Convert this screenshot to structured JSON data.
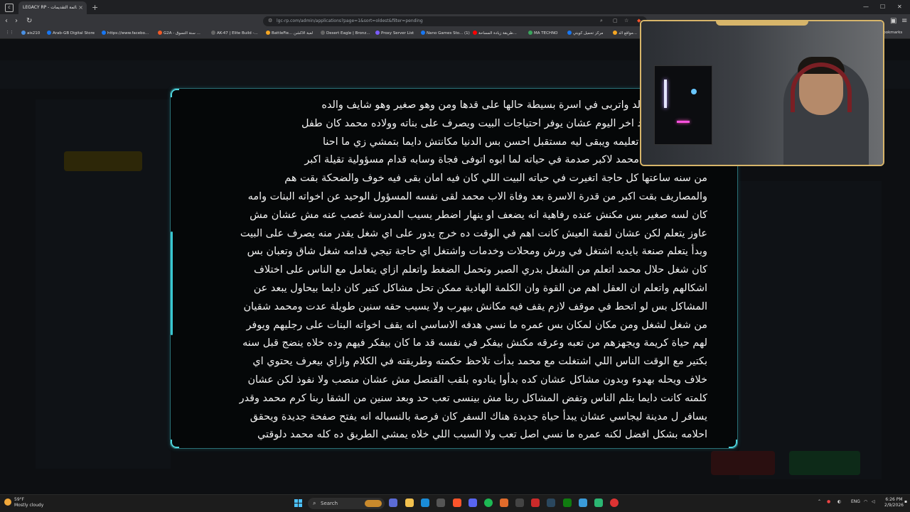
{
  "browser": {
    "tab_title": "LEGACY RP - قائمة التقديمات",
    "tab_close": "×",
    "new_tab": "+",
    "url": "lgc-rp.com/admin/applications?page=1&sort=oldest&filter=pending",
    "bookmarks": [
      {
        "label": "ais210",
        "color": "#4a90e2"
      },
      {
        "label": "Arab-GB Digital Store",
        "color": "#1877f2"
      },
      {
        "label": "https://www.facebo...",
        "color": "#1877f2"
      },
      {
        "label": "G2A - سنة التسوق ...",
        "color": "#f05a28"
      },
      {
        "label": "AK-47 | Elite Build -...",
        "color": "#666666"
      },
      {
        "label": "BattleFie... لعبة الاكشن",
        "color": "#f5a623"
      },
      {
        "label": "Desert Eagle | Bronz...",
        "color": "#666666"
      },
      {
        "label": "Proxy Server List",
        "color": "#7b5cff"
      },
      {
        "label": "Nano Games Sto... (1)",
        "color": "#1877f2"
      },
      {
        "label": "طريقة زيادة المساحة...",
        "color": "#ff0000"
      },
      {
        "label": "MA TECHNO",
        "color": "#3aa55c"
      },
      {
        "label": "مركز تحميل كويتي",
        "color": "#1877f2"
      },
      {
        "label": "مواقع الد...",
        "color": "#f5a623"
      }
    ],
    "all_bookmarks": "All Bookmarks"
  },
  "story": {
    "lines": [
      "شاب مصري اتولد واتربى في اسرة بسيطة حالها على قدها ومن وهو صغير وهو شايف والده",
      "ل من الصبح لحد اخر اليوم عشان يوفر احتياجات البيت ويصرف على بناته وولاده محمد كان طفل",
      "سة بيحلم يكمل تعليمه ويبقى ليه مستقبل احسن بس الدنيا مكانتش دايما بتمشي زي ما احنا",
      "ن صغير اتعرض محمد لاكبر صدمة في حياته لما ابوه اتوفى فجاة وسابه قدام مسؤولية تقيلة اكبر",
      "من سنه ساعتها كل حاجة اتغيرت في حياته البيت اللي كان فيه امان بقى فيه خوف والضحكة بقت هم",
      "والمصاريف بقت اكبر من قدرة الاسرة بعد وفاة الاب محمد لقى نفسه المسؤول الوحيد عن اخواته البنات وامه",
      "كان لسه صغير بس مكنش عنده رفاهية انه يضعف او ينهار اضطر يسيب المدرسة غصب عنه مش عشان مش",
      "عاوز يتعلم لكن عشان لقمة العيش كانت اهم في الوقت ده خرج يدور على اي شغل يقدر منه يصرف على البيت",
      "وبدأ يتعلم صنعة بايديه اشتغل في ورش ومحلات وخدمات واشتغل اي حاجة تيجي قدامه شغل شاق وتعبان بس",
      "كان شغل حلال محمد اتعلم من الشغل بدري الصبر وتحمل الضغط واتعلم ازاي يتعامل مع الناس على اختلاف",
      "اشكالهم واتعلم ان العقل اهم من القوة وان الكلمة الهادية ممكن تحل مشاكل كتير كان دايما بيحاول يبعد عن",
      "المشاكل بس لو اتحط في موقف لازم يقف فيه مكانش بيهرب ولا يسيب حقه سنين طويلة عدت ومحمد شقيان",
      "من شغل لشغل ومن مكان لمكان بس عمره ما نسي هدفه الاساسي انه يقف اخواته البنات على رجليهم ويوفر",
      "لهم حياة كريمة ويجهزهم من تعبه وعرقه مكنش بيفكر في نفسه قد ما كان بيفكر فيهم وده خلاه ينضج قبل سنه",
      "بكتير مع الوقت الناس اللي اشتغلت مع محمد بدأت تلاحظ حكمته وطريقته في الكلام وازاي بيعرف يحتوي اي",
      "خلاف ويحله بهدوء وبدون مشاكل عشان كده بدأوا ينادوه بلقب القنصل مش عشان منصب ولا نفوذ لكن عشان",
      "كلمته كانت دايما بتلم الناس وتفض المشاكل ربنا مش بينسى تعب حد وبعد سنين من الشقا ربنا كرم محمد وقدر",
      "يسافر ل مدينة ليجاسي عشان يبدأ حياة جديدة هناك السفر كان فرصة بالنسباله انه يفتح صفحة جديدة ويحقق",
      "احلامه بشكل افضل لكنه عمره ما نسي اصل تعب ولا السبب اللي خلاه يمشي الطريق ده كله محمد دلوقتي"
    ]
  },
  "taskbar": {
    "temp": "59°F",
    "weather": "Mostly cloudy",
    "search": "Search",
    "lang": "ENG",
    "time": "6:26 PM",
    "date": "2/9/2026"
  }
}
